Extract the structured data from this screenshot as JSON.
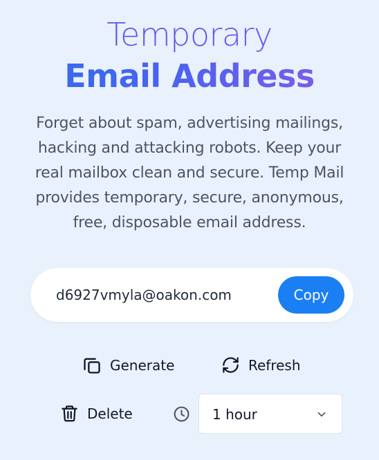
{
  "hero": {
    "title_line1": "Temporary",
    "title_line2": "Email Address",
    "description": "Forget about spam, advertising mailings, hacking and attacking robots. Keep your real mailbox clean and secure. Temp Mail provides temporary, secure, anonymous, free, disposable email address."
  },
  "email_box": {
    "address": "d6927vmyla@oakon.com",
    "copy_label": "Copy"
  },
  "actions": {
    "generate_label": "Generate",
    "refresh_label": "Refresh",
    "delete_label": "Delete"
  },
  "expiry_select": {
    "selected": "1 hour"
  },
  "icons": {
    "generate": "copy-icon",
    "refresh": "refresh-icon",
    "delete": "trash-icon",
    "expiry": "clock-icon",
    "select": "chevron-down-icon"
  },
  "colors": {
    "background": "#e9f1fd",
    "accent": "#1a7ff3",
    "title_gradient_start": "#2f6cf2",
    "title_gradient_end": "#8e5ae8",
    "body_text": "#4b5563"
  }
}
